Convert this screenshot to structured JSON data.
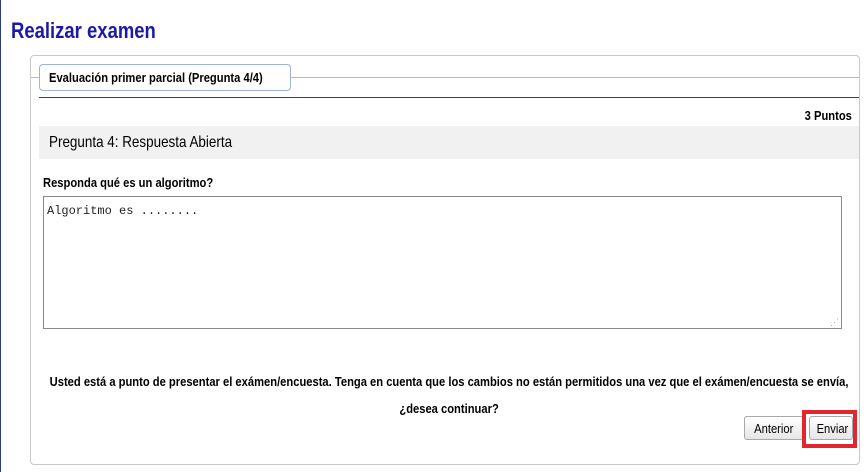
{
  "page": {
    "title": "Realizar examen"
  },
  "fieldset": {
    "legend": "Evaluación primer parcial (Pregunta 4/4)"
  },
  "question": {
    "points": "3 Puntos",
    "title": "Pregunta 4:  Respuesta Abierta",
    "prompt": "Responda qué es un algoritmo?",
    "answer_value": "Algoritmo es ........"
  },
  "confirmation": {
    "message": "Usted está a punto de presentar el exámen/encuesta. Tenga en cuenta que los cambios no están permitidos una vez que el exámen/encuesta se envía, ¿desea continuar?"
  },
  "buttons": {
    "previous_label": "Anterior",
    "submit_label": "Enviar"
  },
  "colors": {
    "title": "#1a1aa6",
    "highlight": "#e3262e"
  }
}
